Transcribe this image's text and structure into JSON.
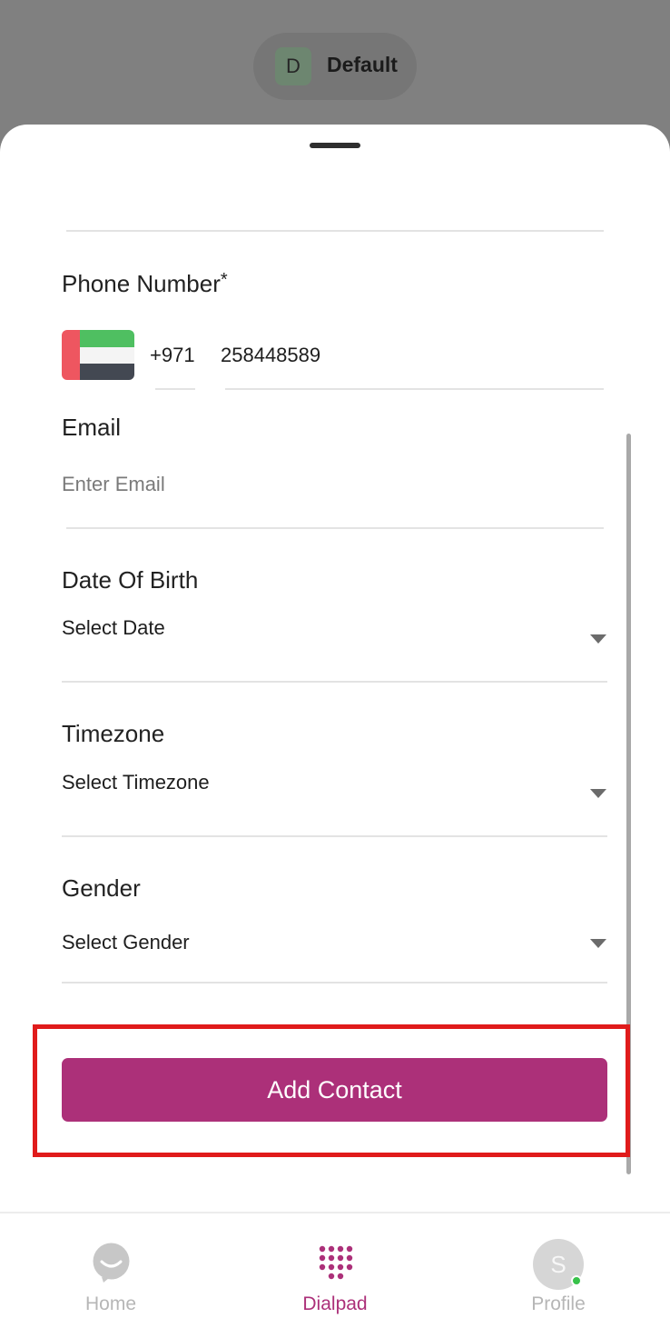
{
  "account": {
    "initial": "D",
    "name": "Default"
  },
  "form": {
    "phone": {
      "label": "Phone Number",
      "required_mark": "*",
      "country_code": "+971",
      "number": "258448589",
      "flag_icon": "uae-flag-icon"
    },
    "email": {
      "label": "Email",
      "placeholder": "Enter Email"
    },
    "dob": {
      "label": "Date Of Birth",
      "value": "Select Date"
    },
    "timezone": {
      "label": "Timezone",
      "value": "Select Timezone"
    },
    "gender": {
      "label": "Gender",
      "value": "Select Gender"
    },
    "submit_label": "Add Contact"
  },
  "nav": {
    "home": {
      "label": "Home"
    },
    "dialpad": {
      "label": "Dialpad"
    },
    "profile": {
      "label": "Profile",
      "initial": "S"
    }
  },
  "colors": {
    "accent": "#ac3079",
    "highlight": "#e01b1b",
    "online": "#38c24a"
  }
}
